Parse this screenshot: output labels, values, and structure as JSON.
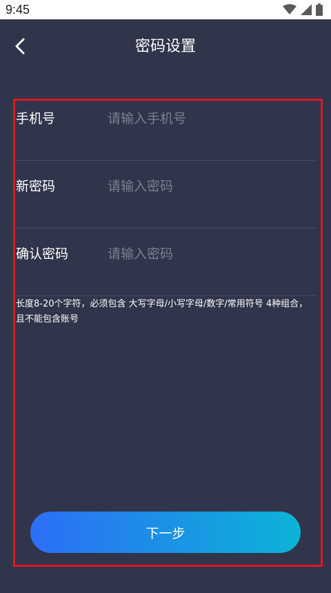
{
  "status_bar": {
    "time": "9:45",
    "icons": [
      "wifi-icon",
      "signal-icon",
      "battery-icon"
    ]
  },
  "header": {
    "back_icon": "chevron-left-icon",
    "title": "密码设置"
  },
  "form": {
    "fields": [
      {
        "label": "手机号",
        "placeholder": "请输入手机号",
        "value": ""
      },
      {
        "label": "新密码",
        "placeholder": "请输入密码",
        "value": ""
      },
      {
        "label": "确认密码",
        "placeholder": "请输入密码",
        "value": ""
      }
    ],
    "hint": "长度8-20个字符，必须包含 大写字母/小写字母/数字/常用符号 4种组合，且不能包含账号",
    "next_label": "下一步"
  },
  "colors": {
    "background": "#30354b",
    "highlight_border": "#e0161e",
    "button_gradient_start": "#2d6ef6",
    "button_gradient_end": "#0bb4d6",
    "placeholder": "#7a7f92"
  }
}
